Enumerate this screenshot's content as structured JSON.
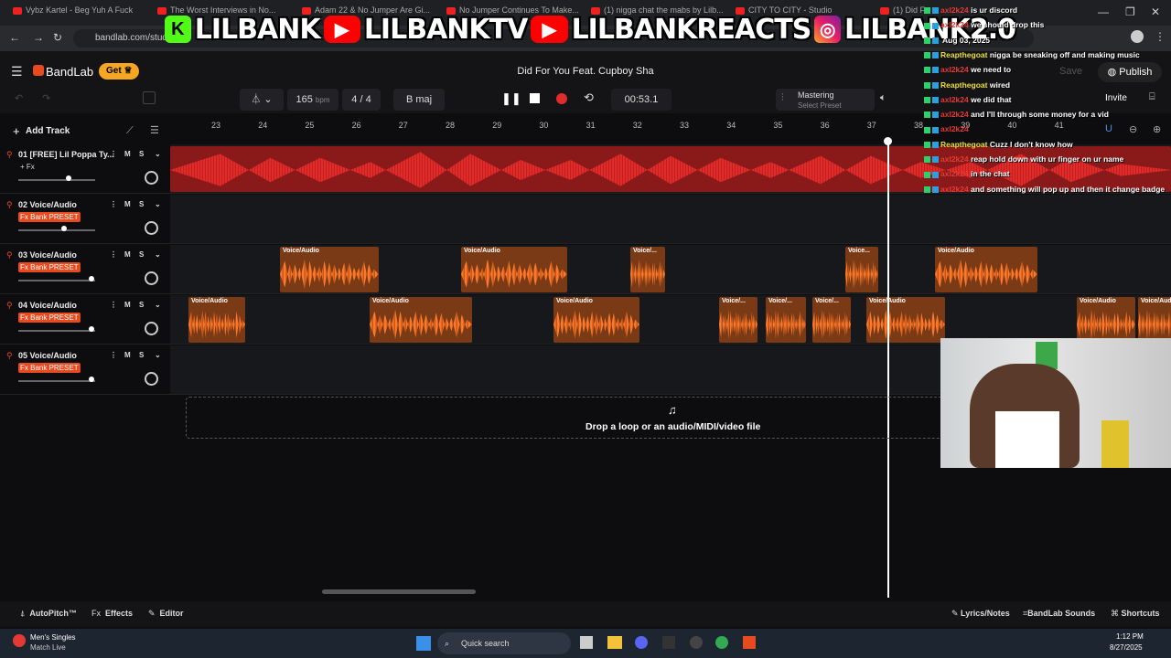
{
  "browser": {
    "tabs": [
      "Vybz Kartel - Beg Yuh A Fuck",
      "The Worst Interviews in No...",
      "Adam 22 & No Jumper Are Gi...",
      "No Jumper Continues To Make...",
      "(1) nigga chat the mabs by Lilb...",
      "CITY TO CITY - Studio",
      "(1) Did F..."
    ],
    "url": "bandlab.com/stud"
  },
  "banner": {
    "items": [
      "LILBANK",
      "LILBANKTV",
      "LILBANKREACTS",
      "LILBANK2.0"
    ]
  },
  "app": {
    "brand": "BandLab",
    "get_label": "Get",
    "song_title": "Did For You Feat. Cupboy Sha",
    "save_label": "Save",
    "publish_label": "Publish",
    "invite_label": "Invite"
  },
  "transport": {
    "tempo": "165",
    "tempo_unit": "bpm",
    "time_sig_num": "4",
    "time_sig_den": "4",
    "key": "B maj",
    "time": "00:53.1",
    "mastering_title": "Mastering",
    "mastering_sub": "Select Preset"
  },
  "add_track_label": "Add Track",
  "ruler": [
    "23",
    "24",
    "25",
    "26",
    "27",
    "28",
    "29",
    "30",
    "31",
    "32",
    "33",
    "34",
    "35",
    "36",
    "37",
    "38",
    "39",
    "40",
    "41"
  ],
  "tracks": [
    {
      "name": "01  [FREE] Lil Poppa Ty...",
      "fx": "+ Fx",
      "volume": 0.65
    },
    {
      "name": "02  Voice/Audio",
      "fx": "Fx Bank PRESET",
      "volume": 0.6
    },
    {
      "name": "03  Voice/Audio",
      "fx": "Fx Bank PRESET",
      "volume": 0.95
    },
    {
      "name": "04  Voice/Audio",
      "fx": "Fx Bank PRESET",
      "volume": 0.95
    },
    {
      "name": "05  Voice/Audio",
      "fx": "Fx Bank PRESET",
      "volume": 0.95
    }
  ],
  "clip_label": "Voice/Audio",
  "clip_short": "Voice/...",
  "clip_tiny": "Voice...",
  "dropzone": "Drop a loop or an audio/MIDI/video file",
  "bottom": {
    "autopitch": "AutoPitch™",
    "effects": "Effects",
    "editor": "Editor",
    "lyrics": "Lyrics/Notes",
    "sounds": "BandLab Sounds",
    "shortcuts": "Shortcuts"
  },
  "taskbar": {
    "widget_title": "Men's Singles",
    "widget_sub": "Match Live",
    "search": "Quick search",
    "time": "1:12 PM",
    "date": "8/27/2025"
  },
  "chat": [
    {
      "user": "axl2k24",
      "msg": "is ur discord",
      "color": "#e53935"
    },
    {
      "user": "axl2k24",
      "msg": "we should drop this",
      "color": "#e53935"
    },
    {
      "user": "",
      "msg": "Aug 03, 2025",
      "color": "#e53935"
    },
    {
      "user": "Reapthegoat",
      "msg": "nigga be sneaking off and making music",
      "color": "#eadf3c"
    },
    {
      "user": "axl2k24",
      "msg": "we need to",
      "color": "#e53935"
    },
    {
      "user": "Reapthegoat",
      "msg": "wired",
      "color": "#eadf3c"
    },
    {
      "user": "axl2k24",
      "msg": "we did that",
      "color": "#e53935"
    },
    {
      "user": "axl2k24",
      "msg": "and I'll through some money for a vid",
      "color": "#e53935"
    },
    {
      "user": "axl2k24",
      "msg": "",
      "color": "#e53935"
    },
    {
      "user": "Reapthegoat",
      "msg": "Cuzz I don't know how",
      "color": "#eadf3c"
    },
    {
      "user": "axl2k24",
      "msg": "reap hold down with ur finger on ur name",
      "color": "#e53935"
    },
    {
      "user": "axl2k24",
      "msg": "in the chat",
      "color": "#e53935"
    },
    {
      "user": "axl2k24",
      "msg": "and something will pop up and then it change badge",
      "color": "#e53935"
    }
  ],
  "colors": {
    "accent": "#e84a1f",
    "master": "#e02b2b",
    "clip": "#f97a2c",
    "get": "#f5a623"
  }
}
